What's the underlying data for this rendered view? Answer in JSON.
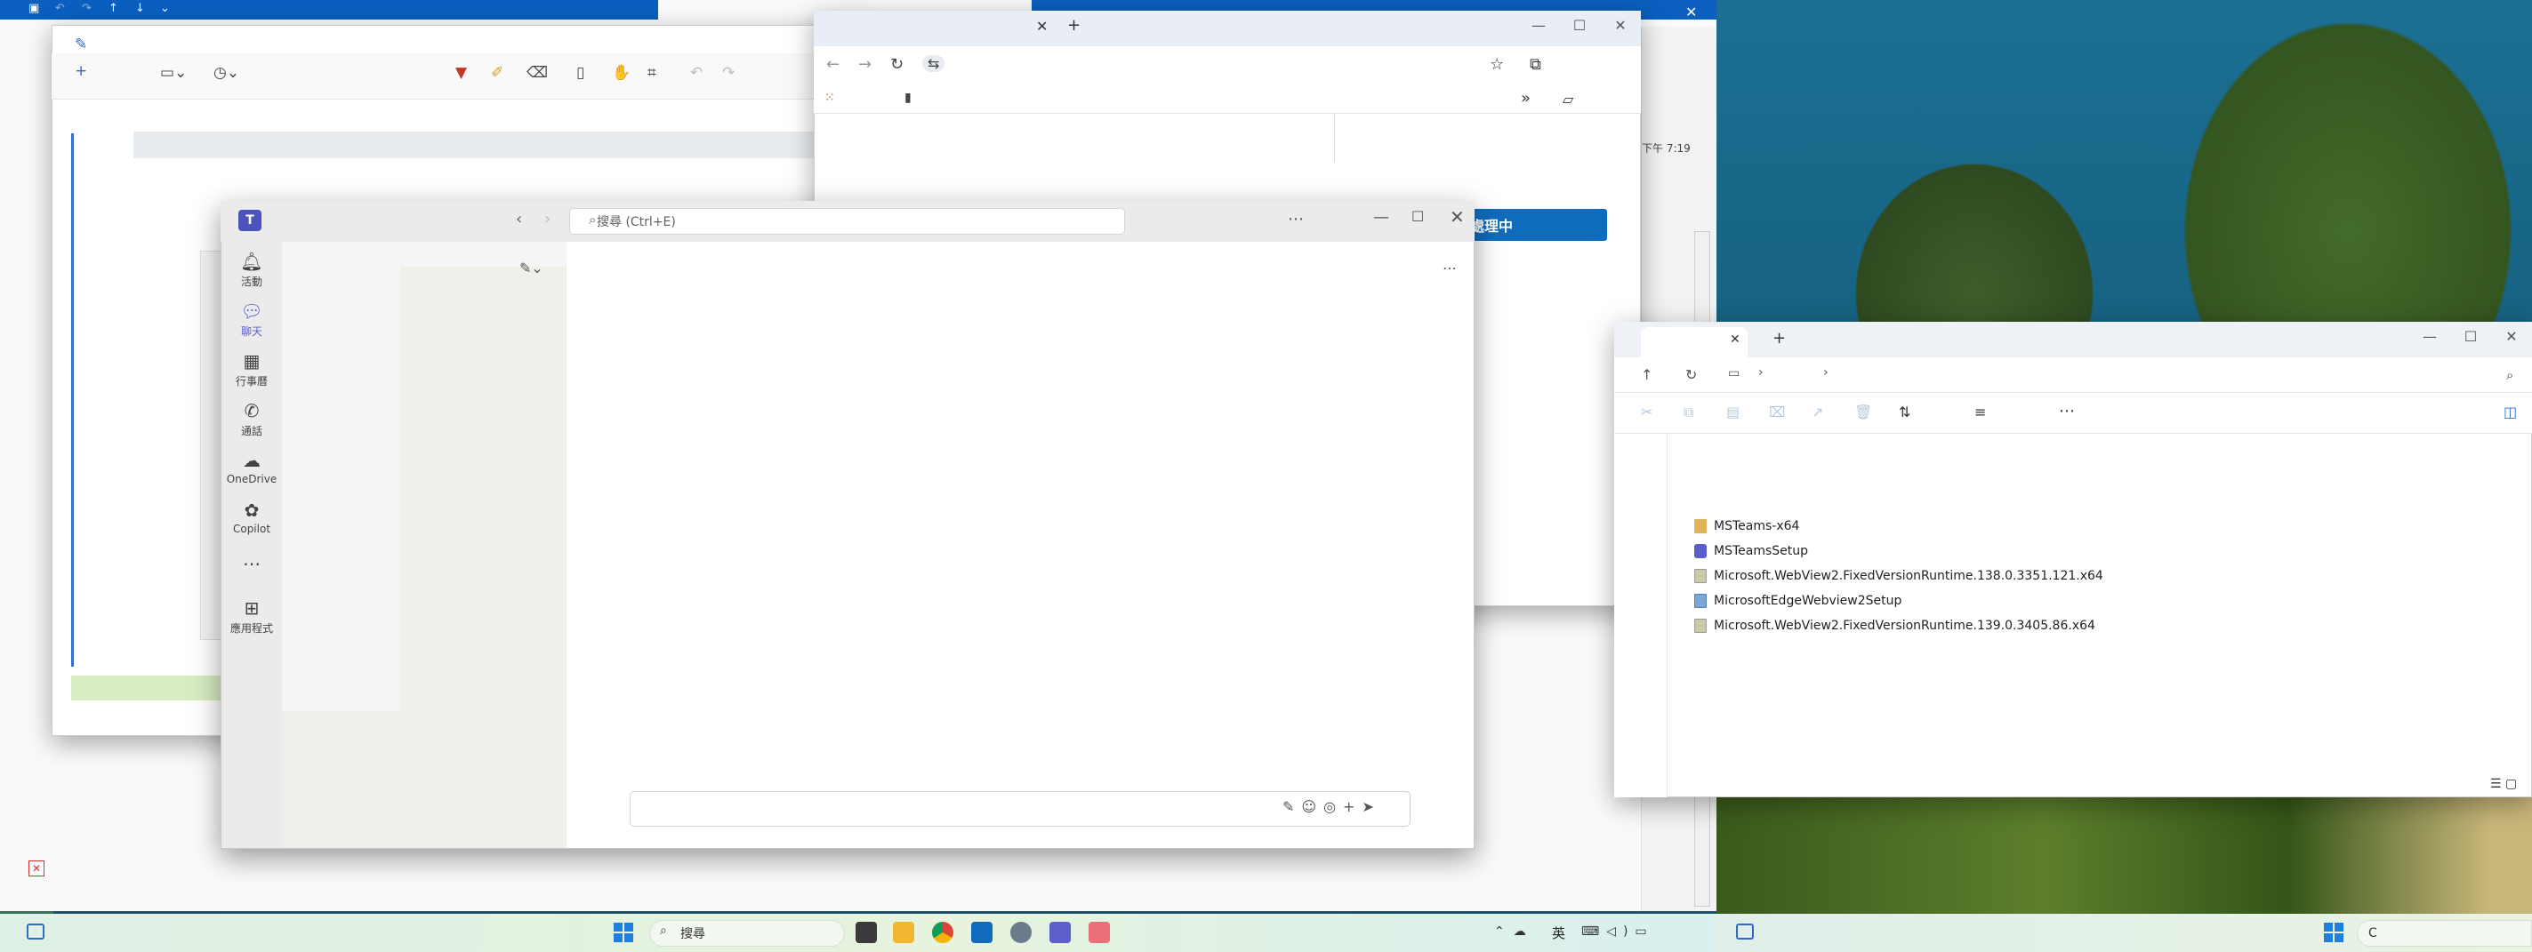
{
  "teams": {
    "search_placeholder": "搜尋 (Ctrl+E)",
    "rail": [
      {
        "label": "活動"
      },
      {
        "label": "聊天"
      },
      {
        "label": "行事曆"
      },
      {
        "label": "通話"
      },
      {
        "label": "OneDrive"
      },
      {
        "label": "Copilot"
      },
      {
        "label": "應用程式"
      }
    ]
  },
  "browser": {
    "blue_button_label": "處理中"
  },
  "doc": {
    "time_text": "下午 7:19"
  },
  "explorer": {
    "files": [
      {
        "name": "MSTeams-x64",
        "icon": "folder-icon"
      },
      {
        "name": "MSTeamsSetup",
        "icon": "teams-app-icon"
      },
      {
        "name": "Microsoft.WebView2.FixedVersionRuntime.138.0.3351.121.x64",
        "icon": "archive-icon"
      },
      {
        "name": "MicrosoftEdgeWebview2Setup",
        "icon": "setup-icon"
      },
      {
        "name": "Microsoft.WebView2.FixedVersionRuntime.139.0.3405.86.x64",
        "icon": "archive-icon"
      }
    ]
  },
  "taskbar": {
    "search_label": "搜尋",
    "ime_label": "英",
    "right_search_label": "C"
  },
  "colors": {
    "teams_accent": "#5b5fc7",
    "windows_blue": "#0a5fbf",
    "button_blue": "#0f6cbd"
  }
}
